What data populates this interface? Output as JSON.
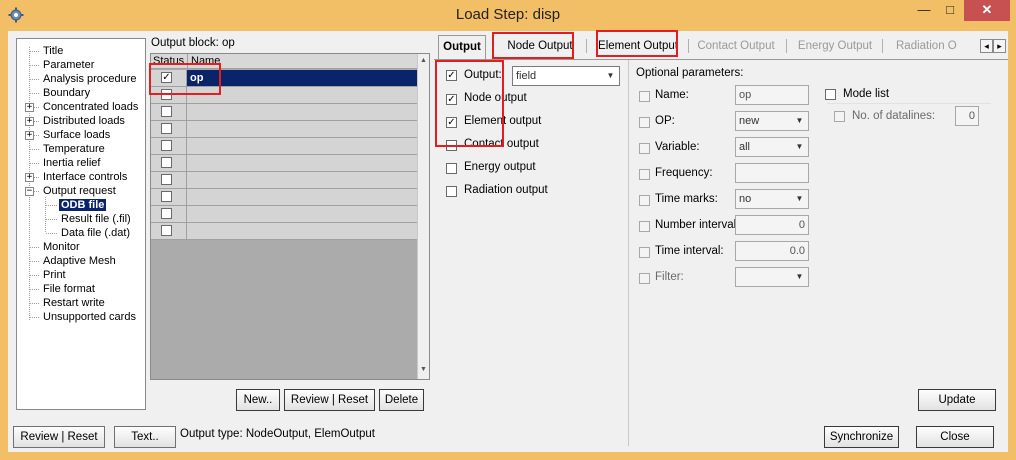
{
  "window": {
    "title": "Load Step: disp",
    "minimize": "—",
    "maximize": "□",
    "close": "✕"
  },
  "tree": {
    "items": [
      {
        "label": "Title"
      },
      {
        "label": "Parameter"
      },
      {
        "label": "Analysis procedure"
      },
      {
        "label": "Boundary"
      },
      {
        "label": "Concentrated loads",
        "expander": "+"
      },
      {
        "label": "Distributed loads",
        "expander": "+"
      },
      {
        "label": "Surface loads",
        "expander": "+"
      },
      {
        "label": "Temperature"
      },
      {
        "label": "Inertia relief"
      },
      {
        "label": "Interface controls",
        "expander": "+"
      },
      {
        "label": "Output request",
        "expander": "−"
      },
      {
        "label": "ODB file",
        "selected": true
      },
      {
        "label": "Result file (.fil)"
      },
      {
        "label": "Data file (.dat)"
      },
      {
        "label": "Monitor"
      },
      {
        "label": "Adaptive Mesh"
      },
      {
        "label": "Print"
      },
      {
        "label": "File format"
      },
      {
        "label": "Restart write"
      },
      {
        "label": "Unsupported cards"
      }
    ]
  },
  "output_block": {
    "label": "Output block: op",
    "col_status": "Status",
    "col_name": "Name",
    "rows": [
      {
        "checked": "✓",
        "name": "op"
      },
      {
        "checked": "",
        "name": ""
      },
      {
        "checked": "",
        "name": ""
      },
      {
        "checked": "",
        "name": ""
      },
      {
        "checked": "",
        "name": ""
      },
      {
        "checked": "",
        "name": ""
      },
      {
        "checked": "",
        "name": ""
      },
      {
        "checked": "",
        "name": ""
      },
      {
        "checked": "",
        "name": ""
      },
      {
        "checked": "",
        "name": ""
      }
    ],
    "new_label": "New..",
    "review_reset_label": "Review | Reset",
    "delete_label": "Delete"
  },
  "tabs": [
    {
      "label": "Output",
      "active": true
    },
    {
      "label": "Node Output"
    },
    {
      "label": "Element Output"
    },
    {
      "label": "Contact Output",
      "disabled": true
    },
    {
      "label": "Energy Output",
      "disabled": true
    },
    {
      "label": "Radiation O",
      "disabled": true
    }
  ],
  "tab_scroll": {
    "left": "◂",
    "right": "▸"
  },
  "output_tab": {
    "output_label": "Output:",
    "output_checked": "✓",
    "output_type": "field",
    "options": [
      {
        "label": "Node output",
        "checked": "✓"
      },
      {
        "label": "Element output",
        "checked": "✓"
      },
      {
        "label": "Contact output",
        "checked": ""
      },
      {
        "label": "Energy output",
        "checked": ""
      },
      {
        "label": "Radiation output",
        "checked": ""
      }
    ]
  },
  "optional": {
    "heading": "Optional parameters:",
    "name_label": "Name:",
    "name_value": "op",
    "op_label": "OP:",
    "op_value": "new",
    "variable_label": "Variable:",
    "variable_value": "all",
    "frequency_label": "Frequency:",
    "frequency_value": "",
    "time_marks_label": "Time marks:",
    "time_marks_value": "no",
    "number_interval_label": "Number interval:",
    "number_interval_value": "0",
    "time_interval_label": "Time interval:",
    "time_interval_value": "0.0",
    "filter_label": "Filter:",
    "filter_value": "",
    "mode_list_label": "Mode list",
    "datalines_label": "No. of datalines:",
    "datalines_value": "0"
  },
  "footer": {
    "review_reset_label": "Review | Reset",
    "text_label": "Text..",
    "output_type_label": "Output type:",
    "output_type_value": "NodeOutput, ElemOutput",
    "update_label": "Update",
    "synchronize_label": "Synchronize",
    "close_label": "Close"
  },
  "colors": {
    "title_bar": "#f2bf66",
    "selection": "#0a246a",
    "annotation": "#e02020"
  }
}
